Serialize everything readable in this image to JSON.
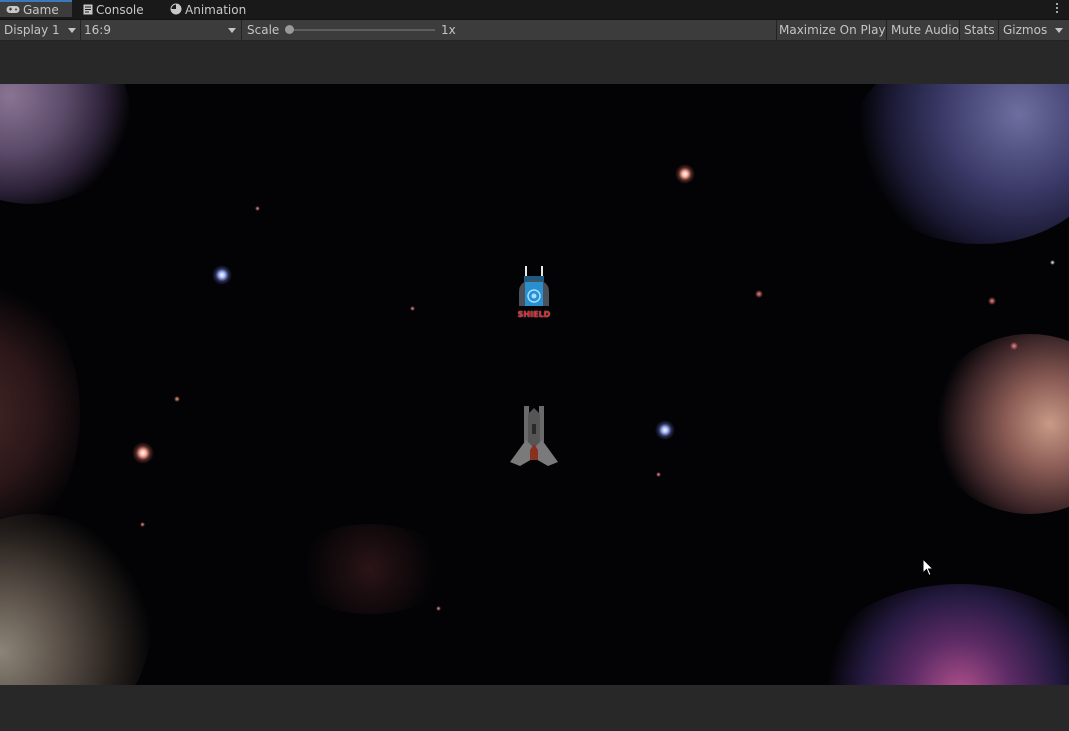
{
  "tabs": [
    {
      "label": "Game",
      "icon": "gamepad-icon",
      "active": true
    },
    {
      "label": "Console",
      "icon": "console-icon",
      "active": false
    },
    {
      "label": "Animation",
      "icon": "animation-clock-icon",
      "active": false
    }
  ],
  "toolbar": {
    "display": "Display 1",
    "aspect": "16:9",
    "scale_label": "Scale",
    "scale_value": "1x",
    "maximize_label": "Maximize On Play",
    "mute_label": "Mute Audio",
    "stats_label": "Stats",
    "gizmos_label": "Gizmos"
  },
  "game": {
    "powerup_label": "SHIELD",
    "colors": {
      "space": "#030305",
      "shield_blue": "#2a8fd0",
      "shield_label": "#e0202a"
    }
  }
}
